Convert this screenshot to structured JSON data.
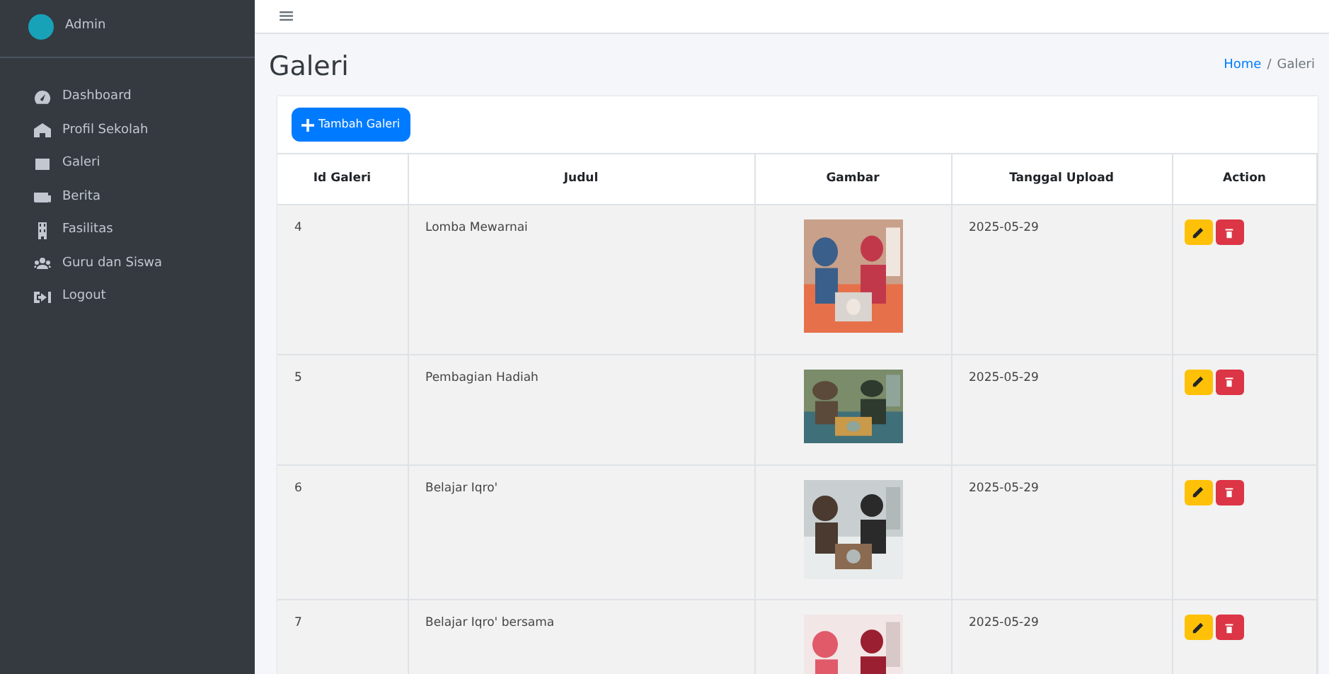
{
  "sidebar": {
    "user": "Admin",
    "items": [
      {
        "label": "Dashboard"
      },
      {
        "label": "Profil Sekolah"
      },
      {
        "label": "Galeri"
      },
      {
        "label": "Berita"
      },
      {
        "label": "Fasilitas"
      },
      {
        "label": "Guru dan Siswa"
      },
      {
        "label": "Logout"
      }
    ]
  },
  "topbar": {
    "menu_toggle": "≡"
  },
  "page": {
    "title": "Galeri",
    "breadcrumb": [
      {
        "label": "Home",
        "kind": "link"
      },
      {
        "label": "/",
        "kind": "separator"
      },
      {
        "label": "Galeri",
        "kind": "current"
      }
    ]
  },
  "add_button": "Tambah Galeri",
  "table": {
    "columns": [
      "Id Galeri",
      "Judul",
      "Gambar",
      "Tanggal Upload",
      "Action"
    ],
    "rows": [
      {
        "id": "4",
        "title": "Lomba Mewarnai",
        "date": "2025-05-29"
      },
      {
        "id": "5",
        "title": "Pembagian Hadiah",
        "date": "2025-05-29"
      },
      {
        "id": "6",
        "title": "Belajar Iqro'",
        "date": "2025-05-29"
      },
      {
        "id": "7",
        "title": "Belajar Iqro' bersama",
        "date": "2025-05-29"
      }
    ]
  }
}
